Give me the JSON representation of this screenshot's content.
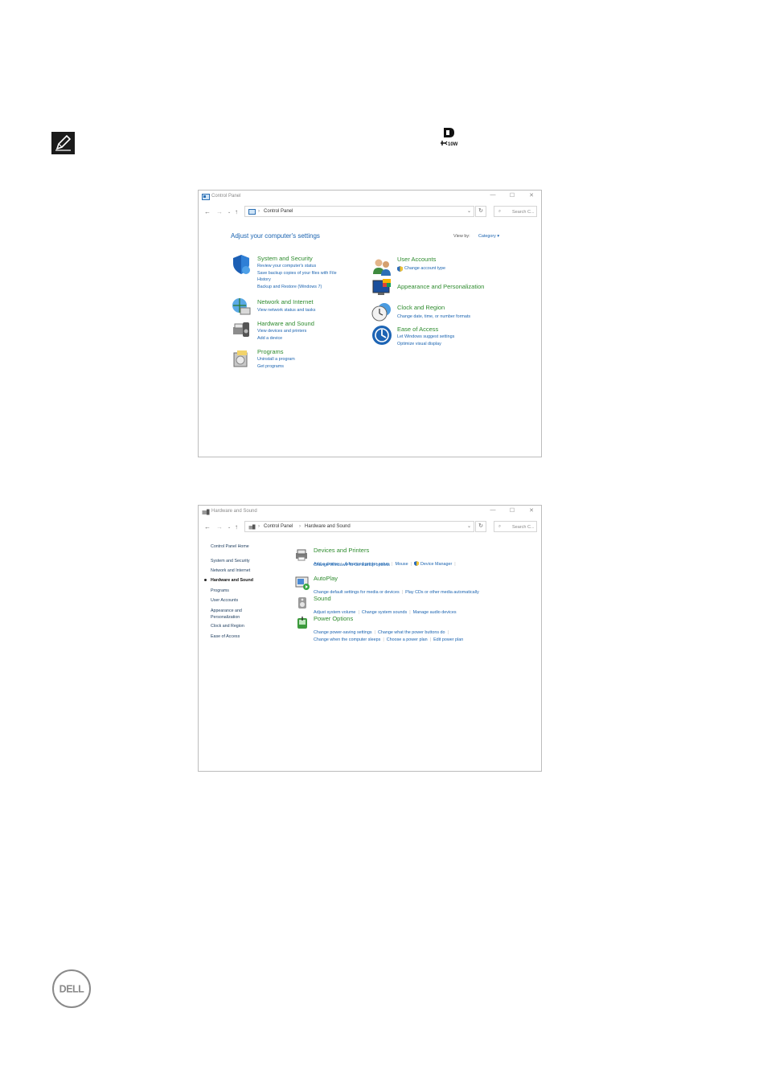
{
  "window1": {
    "title": "Control Panel",
    "breadcrumb": [
      "Control Panel"
    ],
    "search_placeholder": "Search C...",
    "heading": "Adjust your computer's settings",
    "view_by_label": "View by:",
    "view_by_value": "Category",
    "categories_left": [
      {
        "icon": "shield-icon",
        "title": "System and Security",
        "links": [
          "Review your computer's status",
          "Save backup copies of your files with File",
          "History",
          "Backup and Restore (Windows 7)"
        ]
      },
      {
        "icon": "globe-network-icon",
        "title": "Network and Internet",
        "links": [
          "View network status and tasks"
        ]
      },
      {
        "icon": "printer-speaker-icon",
        "title": "Hardware and Sound",
        "links": [
          "View devices and printers",
          "Add a device"
        ]
      },
      {
        "icon": "programs-disk-icon",
        "title": "Programs",
        "links": [
          "Uninstall a program",
          "Get programs"
        ]
      }
    ],
    "categories_right": [
      {
        "icon": "users-icon",
        "title": "User Accounts",
        "links": [
          "Change account type"
        ]
      },
      {
        "icon": "monitor-palette-icon",
        "title": "Appearance and Personalization",
        "links": []
      },
      {
        "icon": "clock-globe-icon",
        "title": "Clock and Region",
        "links": [
          "Change date, time, or number formats"
        ]
      },
      {
        "icon": "ease-of-access-icon",
        "title": "Ease of Access",
        "links": [
          "Let Windows suggest settings",
          "Optimize visual display"
        ]
      }
    ]
  },
  "window2": {
    "title": "Hardware and Sound",
    "breadcrumb": [
      "Control Panel",
      "Hardware and Sound"
    ],
    "search_placeholder": "Search C...",
    "left_nav": [
      "Control Panel Home",
      "System and Security",
      "Network and Internet",
      "Hardware and Sound",
      "Programs",
      "User Accounts",
      "Appearance and",
      "Personalization",
      "Clock and Region",
      "Ease of Access"
    ],
    "sections": [
      {
        "icon": "devices-printers-icon",
        "title": "Devices and Printers",
        "rows": [
          [
            "Add a device",
            "Advanced printer setup",
            "Mouse",
            "Device Manager"
          ],
          [
            "Change Windows To Go startup options"
          ]
        ]
      },
      {
        "icon": "autoplay-icon",
        "title": "AutoPlay",
        "rows": [
          [
            "Change default settings for media or devices",
            "Play CDs or other media automatically"
          ]
        ]
      },
      {
        "icon": "speaker-icon",
        "title": "Sound",
        "rows": [
          [
            "Adjust system volume",
            "Change system sounds",
            "Manage audio devices"
          ]
        ]
      },
      {
        "icon": "power-options-icon",
        "title": "Power Options",
        "rows": [
          [
            "Change power-saving settings",
            "Change what the power buttons do"
          ],
          [
            "Change when the computer sleeps",
            "Choose a power plan",
            "Edit power plan"
          ]
        ]
      }
    ]
  },
  "dp_icon_label": "10W",
  "logo_text": "DELL"
}
